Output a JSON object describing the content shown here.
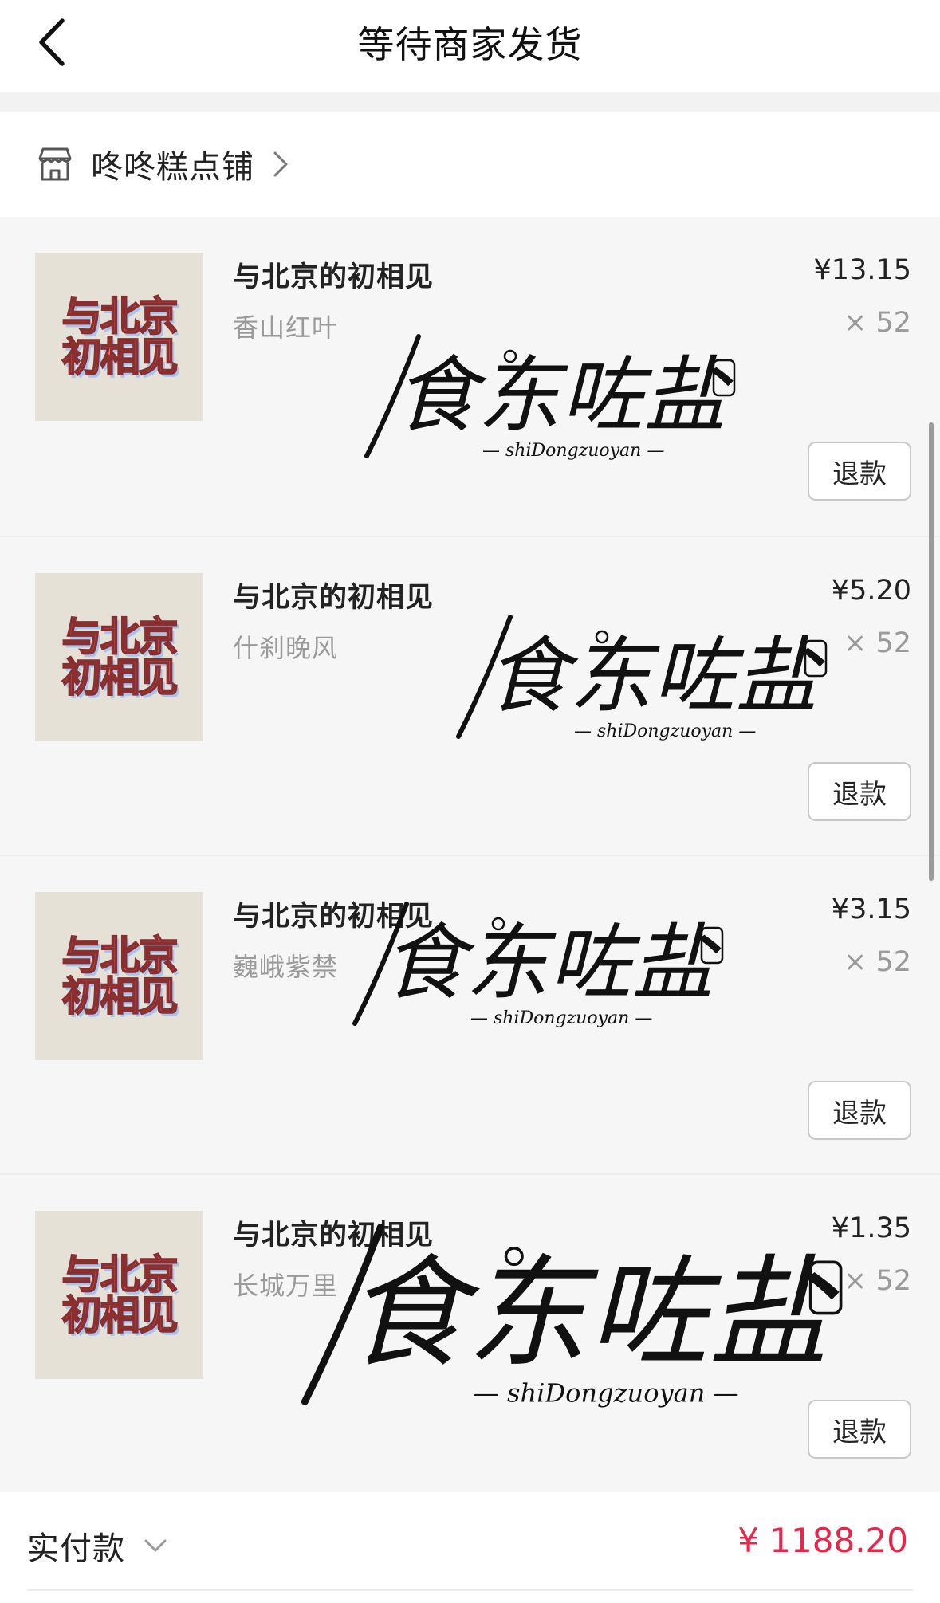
{
  "nav": {
    "title": "等待商家发货",
    "back_icon": "chevron-left-icon"
  },
  "store": {
    "name": "咚咚糕点铺",
    "icon": "store-icon",
    "chevron_icon": "chevron-right-icon"
  },
  "thumbnail": {
    "line1": "与北京",
    "line2": "初相见"
  },
  "products": [
    {
      "name": "与北京的初相见",
      "spec": "香山红叶",
      "price": "¥13.15",
      "qty": "× 52",
      "refund_label": "退款"
    },
    {
      "name": "与北京的初相见",
      "spec": "什刹晚风",
      "price": "¥5.20",
      "qty": "× 52",
      "refund_label": "退款"
    },
    {
      "name": "与北京的初相见",
      "spec": "巍峨紫禁",
      "price": "¥3.15",
      "qty": "× 52",
      "refund_label": "退款"
    },
    {
      "name": "与北京的初相见",
      "spec": "长城万里",
      "price": "¥1.35",
      "qty": "× 52",
      "refund_label": "退款"
    }
  ],
  "watermark": {
    "main": "食东咗盐",
    "sub": "— shiDongzuoyan —"
  },
  "payment": {
    "label": "实付款",
    "amount": "¥ 1188.20",
    "accent": "#e8264a"
  }
}
